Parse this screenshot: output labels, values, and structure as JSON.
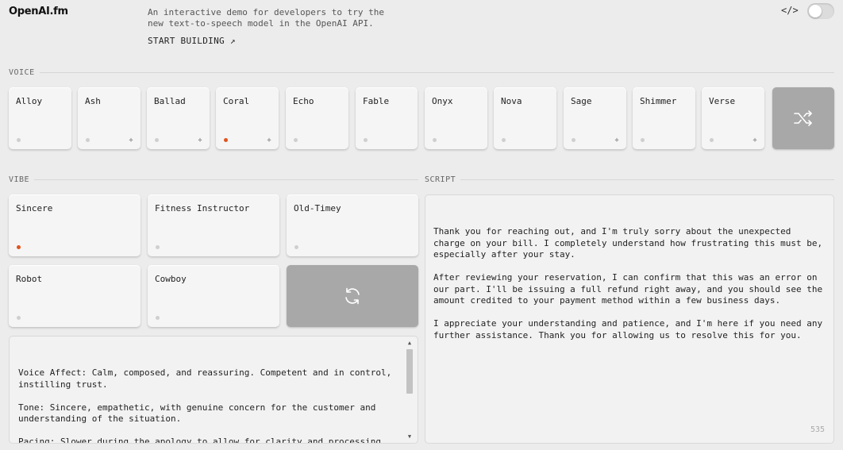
{
  "header": {
    "logo": "OpenAI.fm",
    "tagline": "An interactive demo for developers to try the new text-to-speech model in the OpenAI API.",
    "start_link": "START BUILDING ↗",
    "code_icon": "</>",
    "toggle_state": "off"
  },
  "voice": {
    "label": "VOICE",
    "selected": "Coral",
    "items": [
      {
        "label": "Alloy",
        "spark": ""
      },
      {
        "label": "Ash",
        "spark": "✧"
      },
      {
        "label": "Ballad",
        "spark": "✧"
      },
      {
        "label": "Coral",
        "spark": "✧"
      },
      {
        "label": "Echo",
        "spark": ""
      },
      {
        "label": "Fable",
        "spark": ""
      },
      {
        "label": "Onyx",
        "spark": ""
      },
      {
        "label": "Nova",
        "spark": ""
      },
      {
        "label": "Sage",
        "spark": "✧"
      },
      {
        "label": "Shimmer",
        "spark": ""
      },
      {
        "label": "Verse",
        "spark": "✧"
      }
    ],
    "shuffle_icon": "shuffle-icon"
  },
  "vibe": {
    "label": "VIBE",
    "selected": "Sincere",
    "items": [
      {
        "label": "Sincere"
      },
      {
        "label": "Fitness Instructor"
      },
      {
        "label": "Old-Timey"
      },
      {
        "label": "Robot"
      },
      {
        "label": "Cowboy"
      }
    ],
    "refresh_icon": "refresh-icon",
    "instructions": "Voice Affect: Calm, composed, and reassuring. Competent and in control, instilling trust.\n\nTone: Sincere, empathetic, with genuine concern for the customer and understanding of the situation.\n\nPacing: Slower during the apology to allow for clarity and processing. Faster when offering solutions to signal action and resolution."
  },
  "script": {
    "label": "SCRIPT",
    "text": "Thank you for reaching out, and I'm truly sorry about the unexpected charge on your bill. I completely understand how frustrating this must be, especially after your stay.\n\nAfter reviewing your reservation, I can confirm that this was an error on our part. I'll be issuing a full refund right away, and you should see the amount credited to your payment method within a few business days.\n\nI appreciate your understanding and patience, and I'm here if you need any further assistance. Thank you for allowing us to resolve this for you.",
    "char_count": "535"
  },
  "colors": {
    "accent": "#e0541e",
    "background": "#ececec",
    "card": "#f5f5f5",
    "dark_button": "#a8a8a8"
  }
}
